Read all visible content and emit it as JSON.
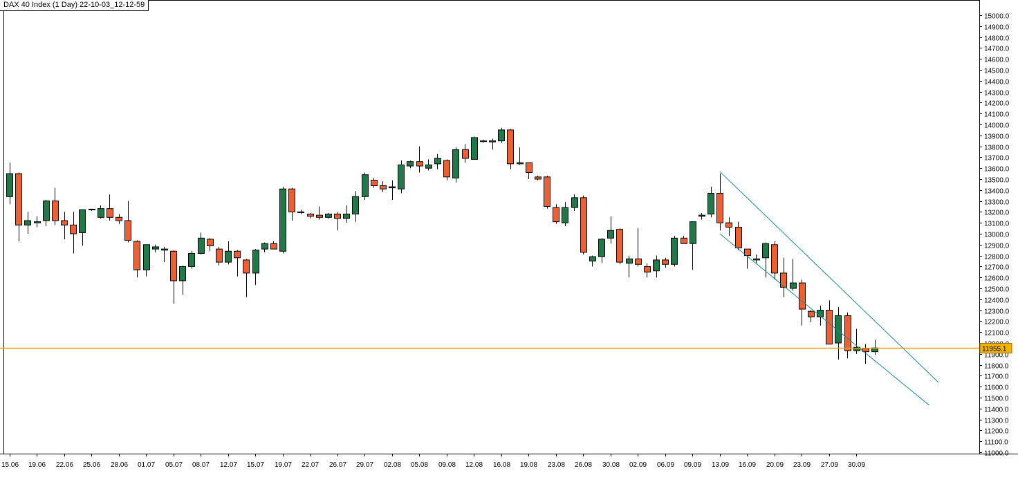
{
  "header": {
    "title": "DAX 40 Index (1 Day) 22-10-03_12-12-59"
  },
  "colors": {
    "up": "#1f7a4a",
    "down": "#ef6030",
    "channel": "#1a8a8a",
    "price_line": "#e8a000",
    "price_label_bg": "#f2b200"
  },
  "chart_data": {
    "type": "candlestick",
    "title": "DAX 40 Index (1 Day) 22-10-03_12-12-59",
    "ylim": [
      11000,
      15000
    ],
    "y_ticks": [
      "15000.0",
      "14900.0",
      "14800.0",
      "14700.0",
      "14600.0",
      "14500.0",
      "14400.0",
      "14300.0",
      "14200.0",
      "14100.0",
      "14000.0",
      "13900.0",
      "13800.0",
      "13700.0",
      "13600.0",
      "13500.0",
      "13400.0",
      "13300.0",
      "13200.0",
      "13100.0",
      "13000.0",
      "12900.0",
      "12800.0",
      "12700.0",
      "12600.0",
      "12500.0",
      "12400.0",
      "12300.0",
      "12200.0",
      "12100.0",
      "12000.0",
      "11900.0",
      "11800.0",
      "11700.0",
      "11600.0",
      "11500.0",
      "11400.0",
      "11300.0",
      "11200.0",
      "11100.0",
      "11000.0"
    ],
    "x_labels": [
      {
        "label": "15.06",
        "index": 0
      },
      {
        "label": "19.06",
        "index": 3
      },
      {
        "label": "22.06",
        "index": 6
      },
      {
        "label": "25.06",
        "index": 9
      },
      {
        "label": "28.06",
        "index": 12
      },
      {
        "label": "01.07",
        "index": 15
      },
      {
        "label": "05.07",
        "index": 18
      },
      {
        "label": "08.07",
        "index": 21
      },
      {
        "label": "12.07",
        "index": 24
      },
      {
        "label": "15.07",
        "index": 27
      },
      {
        "label": "19.07",
        "index": 30
      },
      {
        "label": "22.07",
        "index": 33
      },
      {
        "label": "26.07",
        "index": 36
      },
      {
        "label": "29.07",
        "index": 39
      },
      {
        "label": "02.08",
        "index": 42
      },
      {
        "label": "05.08",
        "index": 45
      },
      {
        "label": "09.08",
        "index": 48
      },
      {
        "label": "12.08",
        "index": 51
      },
      {
        "label": "16.08",
        "index": 54
      },
      {
        "label": "19.08",
        "index": 57
      },
      {
        "label": "23.08",
        "index": 60
      },
      {
        "label": "26.08",
        "index": 63
      },
      {
        "label": "30.08",
        "index": 66
      },
      {
        "label": "02.09",
        "index": 69
      },
      {
        "label": "06.09",
        "index": 72
      },
      {
        "label": "09.09",
        "index": 75
      },
      {
        "label": "13.09",
        "index": 78
      },
      {
        "label": "16.09",
        "index": 81
      },
      {
        "label": "20.09",
        "index": 84
      },
      {
        "label": "23.09",
        "index": 87
      },
      {
        "label": "27.09",
        "index": 90
      },
      {
        "label": "30.09",
        "index": 93
      }
    ],
    "candles": [
      {
        "o": 13340,
        "h": 13650,
        "l": 13270,
        "c": 13550
      },
      {
        "o": 13550,
        "h": 13560,
        "l": 12930,
        "c": 13080
      },
      {
        "o": 13080,
        "h": 13200,
        "l": 13000,
        "c": 13120
      },
      {
        "o": 13100,
        "h": 13160,
        "l": 13060,
        "c": 13110
      },
      {
        "o": 13120,
        "h": 13310,
        "l": 13070,
        "c": 13300
      },
      {
        "o": 13300,
        "h": 13420,
        "l": 13080,
        "c": 13120
      },
      {
        "o": 13120,
        "h": 13200,
        "l": 12950,
        "c": 13080
      },
      {
        "o": 13080,
        "h": 13200,
        "l": 12820,
        "c": 13000
      },
      {
        "o": 13010,
        "h": 13220,
        "l": 12890,
        "c": 13220
      },
      {
        "o": 13220,
        "h": 13230,
        "l": 13210,
        "c": 13225
      },
      {
        "o": 13150,
        "h": 13260,
        "l": 13140,
        "c": 13230
      },
      {
        "o": 13230,
        "h": 13360,
        "l": 13120,
        "c": 13150
      },
      {
        "o": 13150,
        "h": 13180,
        "l": 13090,
        "c": 13120
      },
      {
        "o": 13120,
        "h": 13300,
        "l": 12920,
        "c": 12940
      },
      {
        "o": 12930,
        "h": 12940,
        "l": 12600,
        "c": 12670
      },
      {
        "o": 12670,
        "h": 12900,
        "l": 12610,
        "c": 12900
      },
      {
        "o": 12860,
        "h": 12900,
        "l": 12830,
        "c": 12880
      },
      {
        "o": 12850,
        "h": 12880,
        "l": 12740,
        "c": 12860
      },
      {
        "o": 12840,
        "h": 12850,
        "l": 12360,
        "c": 12570
      },
      {
        "o": 12570,
        "h": 12710,
        "l": 12440,
        "c": 12700
      },
      {
        "o": 12700,
        "h": 12840,
        "l": 12680,
        "c": 12820
      },
      {
        "o": 12820,
        "h": 13010,
        "l": 12810,
        "c": 12960
      },
      {
        "o": 12950,
        "h": 12960,
        "l": 12840,
        "c": 12890
      },
      {
        "o": 12860,
        "h": 12880,
        "l": 12710,
        "c": 12740
      },
      {
        "o": 12740,
        "h": 12930,
        "l": 12720,
        "c": 12840
      },
      {
        "o": 12840,
        "h": 12850,
        "l": 12610,
        "c": 12780
      },
      {
        "o": 12760,
        "h": 12770,
        "l": 12420,
        "c": 12640
      },
      {
        "o": 12640,
        "h": 12860,
        "l": 12530,
        "c": 12850
      },
      {
        "o": 12860,
        "h": 12920,
        "l": 12830,
        "c": 12910
      },
      {
        "o": 12910,
        "h": 12930,
        "l": 12860,
        "c": 12860
      },
      {
        "o": 12840,
        "h": 13430,
        "l": 12820,
        "c": 13410
      },
      {
        "o": 13410,
        "h": 13420,
        "l": 13120,
        "c": 13200
      },
      {
        "o": 13200,
        "h": 13220,
        "l": 13180,
        "c": 13200
      },
      {
        "o": 13180,
        "h": 13190,
        "l": 13140,
        "c": 13160
      },
      {
        "o": 13170,
        "h": 13250,
        "l": 13130,
        "c": 13150
      },
      {
        "o": 13150,
        "h": 13190,
        "l": 13140,
        "c": 13180
      },
      {
        "o": 13180,
        "h": 13200,
        "l": 13030,
        "c": 13140
      },
      {
        "o": 13140,
        "h": 13260,
        "l": 13100,
        "c": 13180
      },
      {
        "o": 13180,
        "h": 13390,
        "l": 13110,
        "c": 13340
      },
      {
        "o": 13340,
        "h": 13560,
        "l": 13310,
        "c": 13540
      },
      {
        "o": 13490,
        "h": 13510,
        "l": 13420,
        "c": 13440
      },
      {
        "o": 13440,
        "h": 13480,
        "l": 13380,
        "c": 13410
      },
      {
        "o": 13420,
        "h": 13490,
        "l": 13310,
        "c": 13430
      },
      {
        "o": 13410,
        "h": 13670,
        "l": 13370,
        "c": 13630
      },
      {
        "o": 13620,
        "h": 13670,
        "l": 13600,
        "c": 13660
      },
      {
        "o": 13660,
        "h": 13800,
        "l": 13560,
        "c": 13620
      },
      {
        "o": 13600,
        "h": 13680,
        "l": 13580,
        "c": 13630
      },
      {
        "o": 13640,
        "h": 13730,
        "l": 13590,
        "c": 13690
      },
      {
        "o": 13670,
        "h": 13680,
        "l": 13490,
        "c": 13520
      },
      {
        "o": 13510,
        "h": 13790,
        "l": 13470,
        "c": 13770
      },
      {
        "o": 13770,
        "h": 13820,
        "l": 13650,
        "c": 13690
      },
      {
        "o": 13680,
        "h": 13890,
        "l": 13680,
        "c": 13880
      },
      {
        "o": 13850,
        "h": 13860,
        "l": 13830,
        "c": 13850
      },
      {
        "o": 13840,
        "h": 13870,
        "l": 13770,
        "c": 13850
      },
      {
        "o": 13850,
        "h": 13970,
        "l": 13830,
        "c": 13950
      },
      {
        "o": 13950,
        "h": 13960,
        "l": 13590,
        "c": 13640
      },
      {
        "o": 13640,
        "h": 13790,
        "l": 13630,
        "c": 13650
      },
      {
        "o": 13650,
        "h": 13650,
        "l": 13500,
        "c": 13560
      },
      {
        "o": 13520,
        "h": 13530,
        "l": 13490,
        "c": 13500
      },
      {
        "o": 13520,
        "h": 13530,
        "l": 13230,
        "c": 13250
      },
      {
        "o": 13240,
        "h": 13270,
        "l": 13090,
        "c": 13110
      },
      {
        "o": 13100,
        "h": 13290,
        "l": 13070,
        "c": 13240
      },
      {
        "o": 13240,
        "h": 13360,
        "l": 13210,
        "c": 13330
      },
      {
        "o": 13330,
        "h": 13350,
        "l": 12810,
        "c": 12830
      },
      {
        "o": 12750,
        "h": 12800,
        "l": 12700,
        "c": 12790
      },
      {
        "o": 12790,
        "h": 12960,
        "l": 12730,
        "c": 12950
      },
      {
        "o": 12960,
        "h": 13160,
        "l": 12910,
        "c": 13030
      },
      {
        "o": 13040,
        "h": 13050,
        "l": 12720,
        "c": 12740
      },
      {
        "o": 12730,
        "h": 12800,
        "l": 12600,
        "c": 12770
      },
      {
        "o": 12770,
        "h": 13050,
        "l": 12700,
        "c": 12720
      },
      {
        "o": 12700,
        "h": 12730,
        "l": 12600,
        "c": 12650
      },
      {
        "o": 12660,
        "h": 12800,
        "l": 12600,
        "c": 12760
      },
      {
        "o": 12760,
        "h": 12780,
        "l": 12690,
        "c": 12720
      },
      {
        "o": 12720,
        "h": 12980,
        "l": 12700,
        "c": 12960
      },
      {
        "o": 12960,
        "h": 12980,
        "l": 12910,
        "c": 12910
      },
      {
        "o": 12910,
        "h": 13050,
        "l": 12670,
        "c": 13110
      },
      {
        "o": 13160,
        "h": 13190,
        "l": 13130,
        "c": 13170
      },
      {
        "o": 13180,
        "h": 13430,
        "l": 13150,
        "c": 13370
      },
      {
        "o": 13370,
        "h": 13550,
        "l": 13030,
        "c": 13100
      },
      {
        "o": 13100,
        "h": 13150,
        "l": 12980,
        "c": 13060
      },
      {
        "o": 13060,
        "h": 13110,
        "l": 12850,
        "c": 12870
      },
      {
        "o": 12860,
        "h": 12860,
        "l": 12680,
        "c": 12800
      },
      {
        "o": 12760,
        "h": 12810,
        "l": 12730,
        "c": 12770
      },
      {
        "o": 12780,
        "h": 12920,
        "l": 12600,
        "c": 12910
      },
      {
        "o": 12900,
        "h": 12930,
        "l": 12580,
        "c": 12640
      },
      {
        "o": 12640,
        "h": 12780,
        "l": 12420,
        "c": 12510
      },
      {
        "o": 12500,
        "h": 12770,
        "l": 12480,
        "c": 12550
      },
      {
        "o": 12550,
        "h": 12580,
        "l": 12160,
        "c": 12310
      },
      {
        "o": 12290,
        "h": 12300,
        "l": 12190,
        "c": 12240
      },
      {
        "o": 12240,
        "h": 12340,
        "l": 12160,
        "c": 12300
      },
      {
        "o": 12300,
        "h": 12390,
        "l": 12000,
        "c": 11990
      },
      {
        "o": 12000,
        "h": 12330,
        "l": 11850,
        "c": 12250
      },
      {
        "o": 12250,
        "h": 12280,
        "l": 11860,
        "c": 11930
      },
      {
        "o": 11930,
        "h": 12130,
        "l": 11900,
        "c": 11960
      },
      {
        "o": 11950,
        "h": 11990,
        "l": 11810,
        "c": 11920
      },
      {
        "o": 11920,
        "h": 12030,
        "l": 11890,
        "c": 11955
      }
    ],
    "current_price": 11955.1,
    "current_price_label": "11955.1",
    "channel_lines": [
      {
        "x_start": 78,
        "y_start": 13570,
        "x_end": 102,
        "y_end": 11640
      },
      {
        "x_start": 78,
        "y_start": 13000,
        "x_end": 101,
        "y_end": 11430
      }
    ]
  }
}
